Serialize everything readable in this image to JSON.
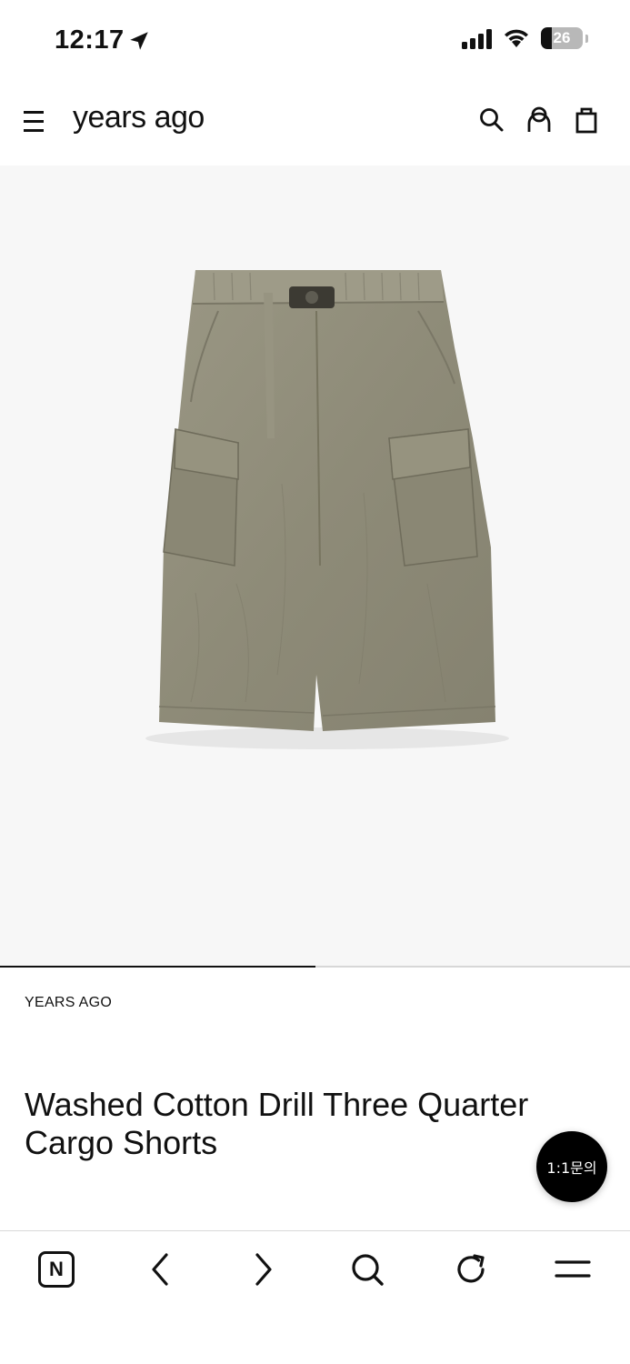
{
  "status_bar": {
    "time": "12:17",
    "battery_level": "26",
    "battery_fraction": 0.26,
    "icons": [
      "location-arrow-icon",
      "cellular-signal-icon",
      "wifi-icon",
      "battery-icon"
    ]
  },
  "header": {
    "logo_text": "years ago",
    "icons": [
      "menu-icon",
      "search-icon",
      "account-icon",
      "shopping-bag-icon"
    ]
  },
  "gallery": {
    "image_description": "khaki cargo shorts",
    "progress_fraction": 0.5
  },
  "product": {
    "brand": "YEARS AGO",
    "title": "Washed Cotton Drill Three Quarter Cargo Shorts"
  },
  "chat_button": {
    "label": "1:1문의"
  },
  "browser_bar": {
    "items": [
      "naver-home-icon",
      "back-icon",
      "forward-icon",
      "search-icon",
      "reload-icon",
      "menu-icon"
    ],
    "naver_letter": "N"
  },
  "colors": {
    "shorts": "#8e8b7a",
    "image_bg": "#f7f7f7",
    "chat_bg": "#000000"
  }
}
